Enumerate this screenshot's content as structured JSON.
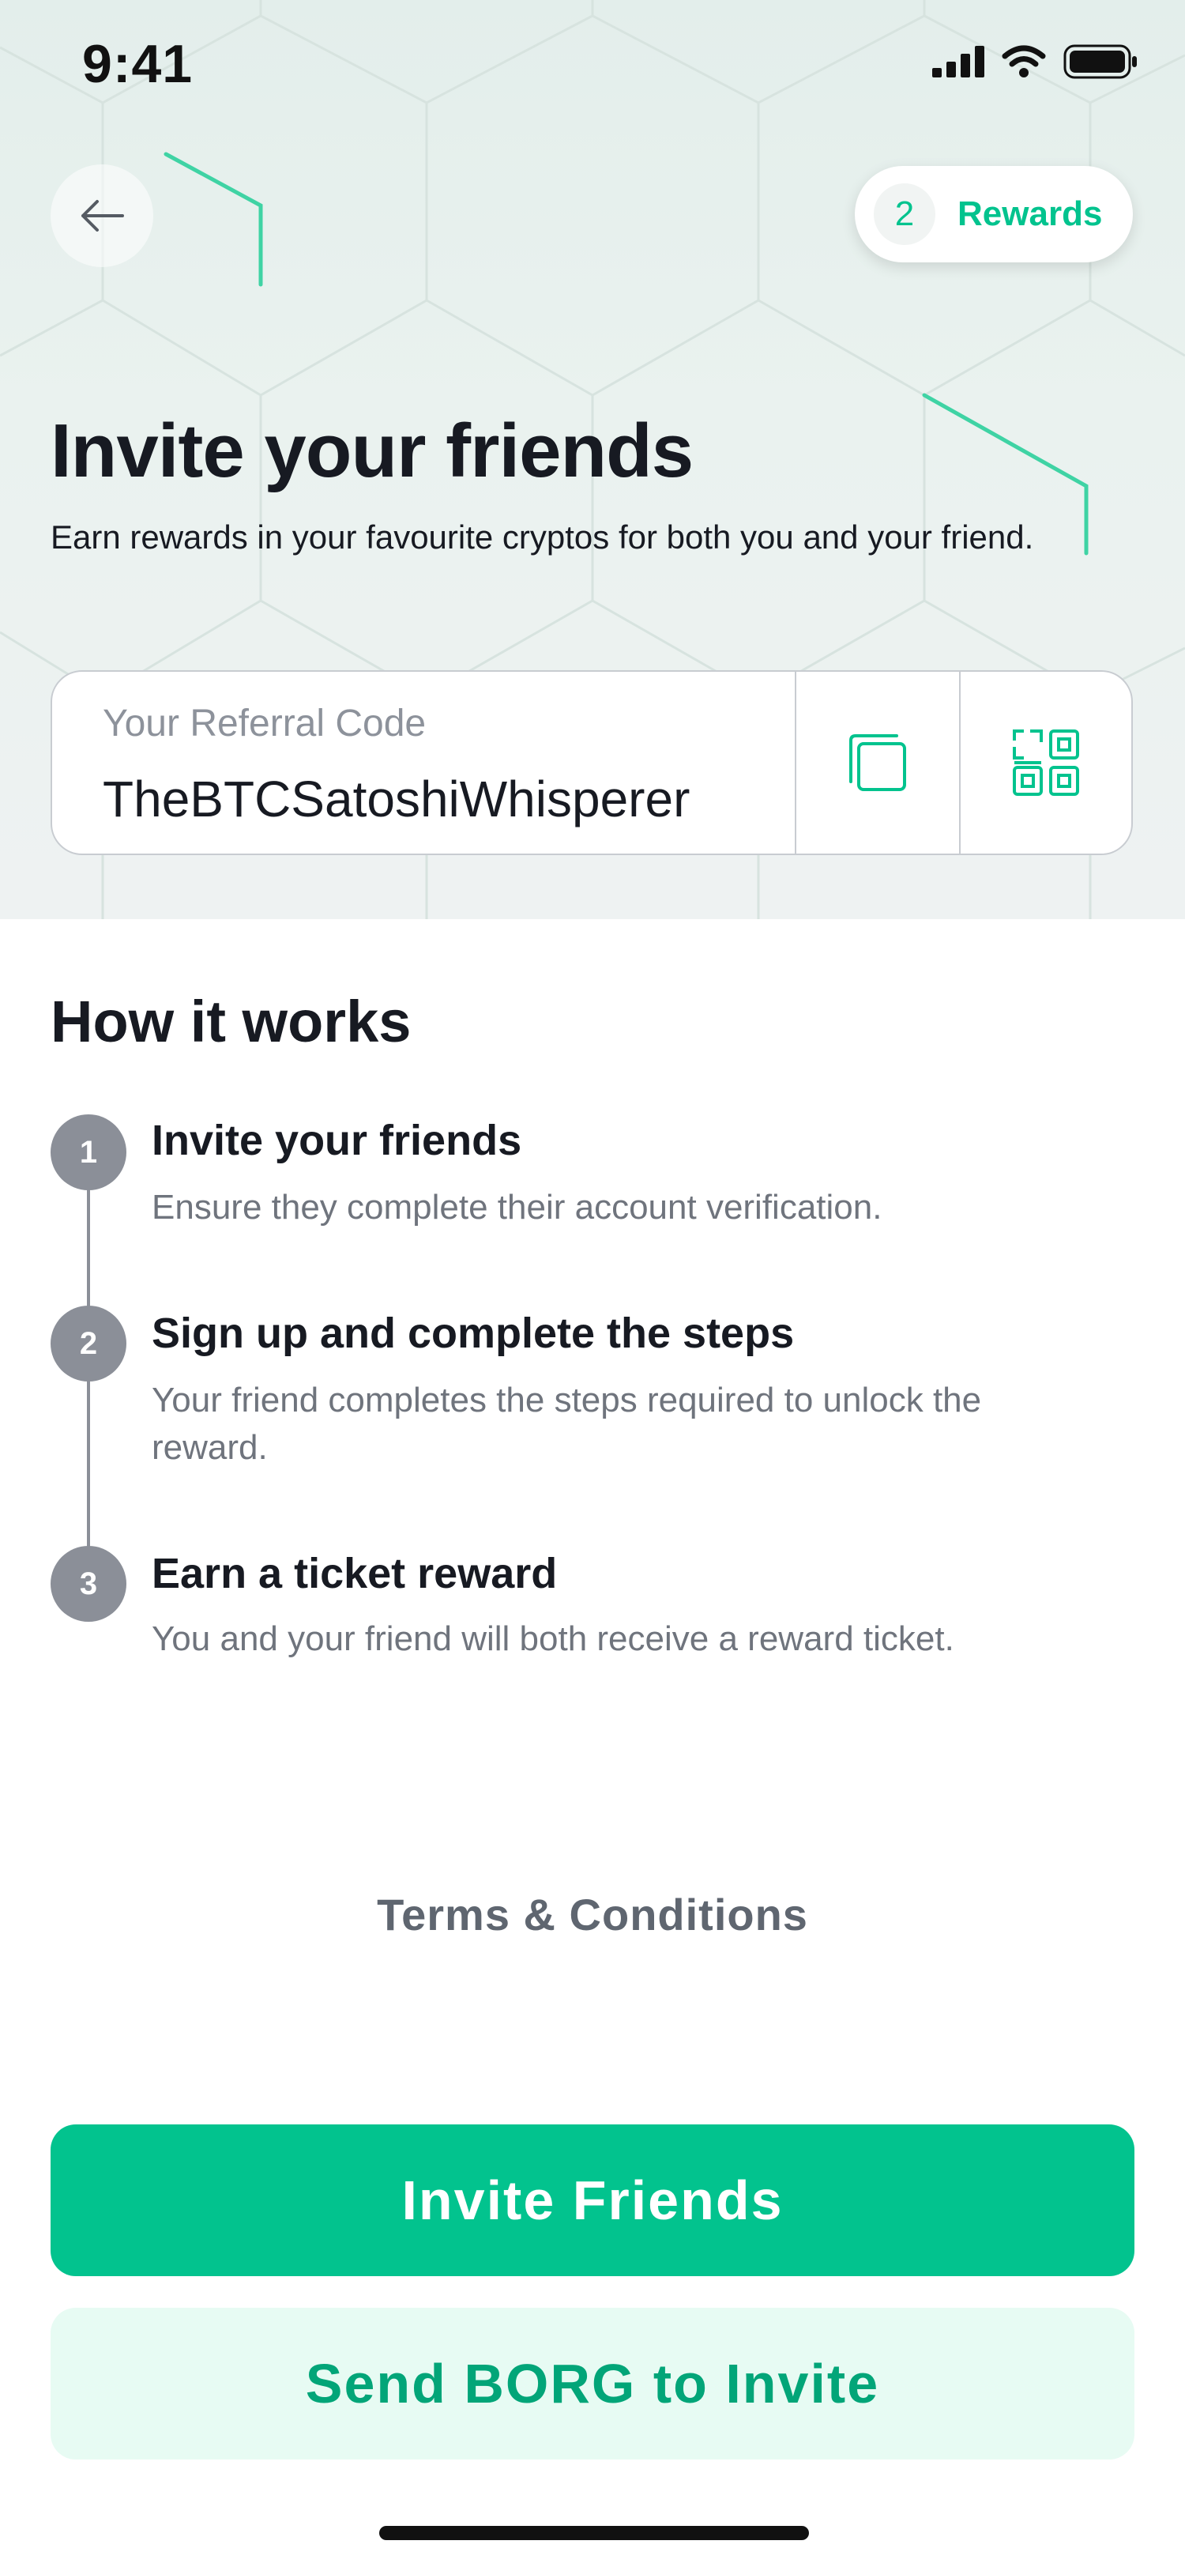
{
  "status_bar": {
    "time": "9:41"
  },
  "header": {
    "rewards_count": "2",
    "rewards_label": "Rewards"
  },
  "hero": {
    "title": "Invite your friends",
    "subtitle": "Earn rewards in your favourite cryptos for both you and your friend."
  },
  "referral": {
    "label": "Your Referral Code",
    "code": "TheBTCSatoshiWhisperer"
  },
  "how_it_works": {
    "title": "How it works",
    "steps": [
      {
        "number": "1",
        "title": "Invite your friends",
        "description": "Ensure they complete their account verification."
      },
      {
        "number": "2",
        "title": "Sign up and complete the steps",
        "description": "Your friend completes the steps required to unlock the reward."
      },
      {
        "number": "3",
        "title": "Earn a ticket reward",
        "description": "You and your friend will both receive a reward ticket."
      }
    ]
  },
  "terms_label": "Terms & Conditions",
  "actions": {
    "primary_label": "Invite Friends",
    "secondary_label": "Send BORG to Invite"
  },
  "colors": {
    "accent": "#02c38e",
    "secondary_bg": "#e7fbf3",
    "step_badge": "#8b8f98"
  },
  "icons": [
    "back-arrow-icon",
    "copy-icon",
    "qr-code-icon",
    "signal-icon",
    "wifi-icon",
    "battery-icon"
  ]
}
